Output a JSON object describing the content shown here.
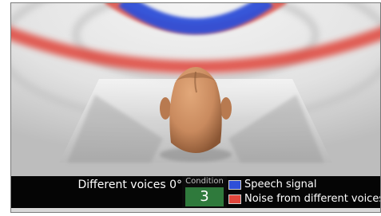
{
  "caption": {
    "description": "Different voices 0°",
    "condition_label": "Condition",
    "condition_number": "3"
  },
  "legend": [
    {
      "label": "Speech signal",
      "color": "#2e4fd8"
    },
    {
      "label": "Noise from different voices",
      "color": "#e0453b"
    }
  ],
  "scene": {
    "speech_color": "#2e4fd8",
    "noise_color": "#e0453b",
    "head_color": "#c98a5e"
  }
}
